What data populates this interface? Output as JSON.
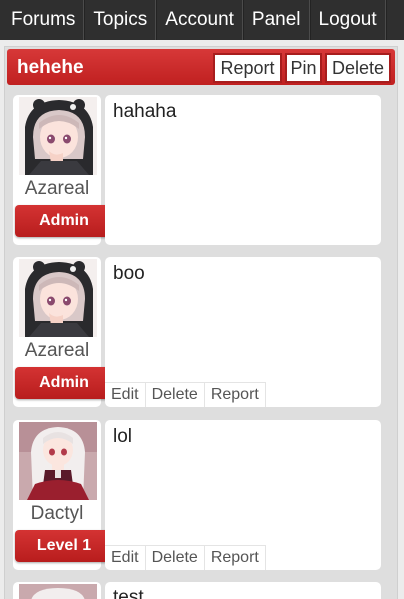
{
  "nav": {
    "items": [
      {
        "label": "Forums"
      },
      {
        "label": "Topics"
      },
      {
        "label": "Account"
      },
      {
        "label": "Panel"
      },
      {
        "label": "Logout"
      }
    ]
  },
  "topic": {
    "title": "hehehe",
    "report_label": "Report",
    "pin_label": "Pin",
    "delete_label": "Delete"
  },
  "posts": [
    {
      "username": "Azareal",
      "rank": "Admin",
      "text": "hahaha",
      "controls": []
    },
    {
      "username": "Azareal",
      "rank": "Admin",
      "text": "boo",
      "controls": [
        "Edit",
        "Delete",
        "Report"
      ]
    },
    {
      "username": "Dactyl",
      "rank": "Level 1",
      "text": "lol",
      "controls": [
        "Edit",
        "Delete",
        "Report"
      ]
    },
    {
      "username": "",
      "rank": "",
      "text": "test",
      "controls": []
    }
  ],
  "colors": {
    "nav_bg": "#2f2f2f",
    "accent": "#c92a2a",
    "frame_bg": "#dedede"
  }
}
